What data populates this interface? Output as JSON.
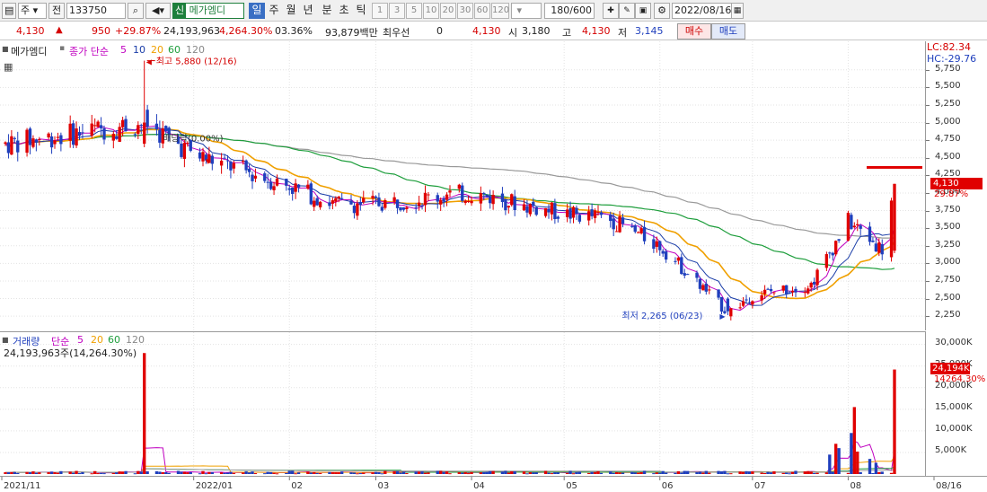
{
  "toolbar": {
    "period_unit": "주",
    "prev_label": "전",
    "code": "133750",
    "new_badge": "신",
    "stock_name": "메가엠디",
    "periods": [
      "일",
      "주",
      "월",
      "년",
      "분",
      "초",
      "틱"
    ],
    "active_period": "일",
    "minute_steps": [
      "1",
      "3",
      "5",
      "10",
      "20",
      "30",
      "60",
      "120"
    ],
    "count": "180/600",
    "date": "2022/08/16"
  },
  "quote": {
    "price": "4,130",
    "change": "950",
    "change_pct": "+29.87%",
    "volume": "24,193,963",
    "volume_ratio": "4,264.30%",
    "turnover_rate": "03.36%",
    "amount": "93,879백만",
    "best_label": "최우선",
    "best_value": "0",
    "best_price": "4,130",
    "open_label": "시",
    "open": "3,180",
    "high_label": "고",
    "high": "4,130",
    "low_label": "저",
    "low": "3,145",
    "buy_label": "매수",
    "sell_label": "매도"
  },
  "price_panel": {
    "stock_label": "메가엠디",
    "ma_title": "종가 단순",
    "ma_periods": [
      "5",
      "10",
      "20",
      "60",
      "120"
    ],
    "ma_colors": [
      "#c000c0",
      "#1a3da8",
      "#f0a000",
      "#1e9e3c",
      "#999999"
    ],
    "lc": "LC:82.34",
    "hc": "HC:-29.76",
    "high_note": "최고 5,880 (12/16)",
    "low_note": "최저 2,265 (06/23)",
    "dividend_note": "배당락(0.00%)",
    "last_price": "4,130",
    "last_pct": "29.87%"
  },
  "volume_panel": {
    "title": "거래량",
    "ma_title": "단순",
    "ma_periods": [
      "5",
      "20",
      "60",
      "120"
    ],
    "summary": "24,193,963주(14,264.30%)",
    "last_volume": "24,194K",
    "last_pct": "14264.30%"
  },
  "x_axis": [
    "2021/11",
    "2022/01",
    "02",
    "03",
    "04",
    "05",
    "06",
    "07",
    "08",
    "08/16"
  ],
  "price_axis": [
    "5,750",
    "5,500",
    "5,250",
    "5,000",
    "4,750",
    "4,500",
    "4,250",
    "4,000",
    "3,750",
    "3,500",
    "3,250",
    "3,000",
    "2,750",
    "2,500",
    "2,250"
  ],
  "volume_axis": [
    "30,000K",
    "25,000K",
    "20,000K",
    "15,000K",
    "10,000K",
    "5,000K"
  ],
  "chart_data": {
    "type": "candlestick",
    "price_range": [
      2150,
      5900
    ],
    "volume_range": [
      0,
      32000000
    ],
    "anchors": [
      {
        "date": "2021-11-01",
        "close": 4700
      },
      {
        "date": "2021-12-16",
        "close": 5000
      },
      {
        "date": "2022-01-01",
        "close": 4550
      },
      {
        "date": "2022-02-01",
        "close": 4100
      },
      {
        "date": "2022-02-15",
        "close": 3850
      },
      {
        "date": "2022-03-01",
        "close": 3850
      },
      {
        "date": "2022-04-01",
        "close": 4000
      },
      {
        "date": "2022-05-01",
        "close": 3700
      },
      {
        "date": "2022-05-15",
        "close": 3650
      },
      {
        "date": "2022-06-01",
        "close": 3250
      },
      {
        "date": "2022-06-23",
        "close": 2300
      },
      {
        "date": "2022-07-01",
        "close": 2550
      },
      {
        "date": "2022-07-20",
        "close": 2700
      },
      {
        "date": "2022-08-01",
        "close": 3600
      },
      {
        "date": "2022-08-12",
        "close": 3200
      },
      {
        "date": "2022-08-16",
        "close": 4130
      }
    ],
    "high_point": {
      "date": "2021-12-16",
      "price": 5880
    },
    "low_point": {
      "date": "2022-06-23",
      "price": 2265
    },
    "last_candle": {
      "date": "2022-08-16",
      "open": 3180,
      "high": 4130,
      "low": 3145,
      "close": 4130,
      "volume": 24193963
    },
    "volume_spikes": [
      {
        "date": "2021-12-16",
        "volume": 28000000
      },
      {
        "date": "2022-07-28",
        "volume": 7000000
      },
      {
        "date": "2022-08-03",
        "volume": 15500000
      },
      {
        "date": "2022-08-16",
        "volume": 24193963
      }
    ]
  }
}
